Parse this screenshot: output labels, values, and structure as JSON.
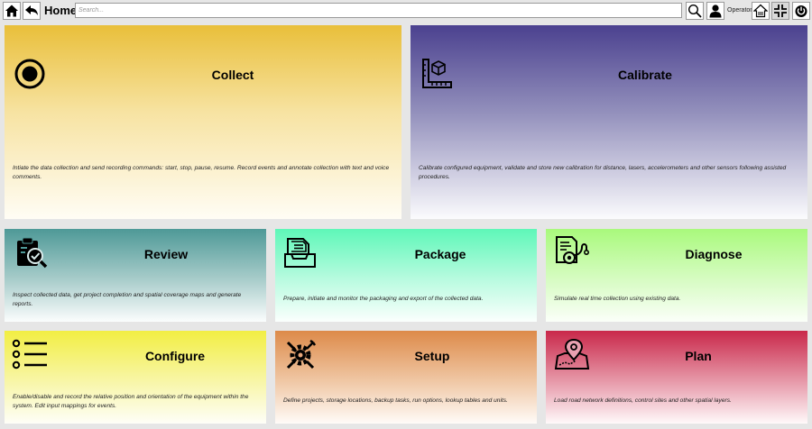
{
  "header": {
    "title": "Home",
    "search_placeholder": "Search...",
    "operator_label": "Operator",
    "icons": [
      "home-icon",
      "back-arrow-icon",
      "search-icon",
      "user-icon",
      "home-outline-icon",
      "minimize-icon",
      "power-icon"
    ]
  },
  "cards": {
    "collect": {
      "title": "Collect",
      "description": "Intiate the data collection and send recording commands: start, stop, pause, resume.  Record events and annotate collection with text and voice comments."
    },
    "calibrate": {
      "title": "Calibrate",
      "description": "Calibrate configured equipment, validate and store new calibration for distance, lasers, accelerometers and other sensors following assisted procedures."
    },
    "review": {
      "title": "Review",
      "description": "Inspect collected data, get project completion and spatial coverage maps and generate reports."
    },
    "package": {
      "title": "Package",
      "description": "Prepare, initiate and monitor the packaging and export of the collected data."
    },
    "diagnose": {
      "title": "Diagnose",
      "description": "Simulate real time collection using existing data."
    },
    "configure": {
      "title": "Configure",
      "description": "Enable/disable and record the relative position and orientation of the equipment within the system.  Edit input mappings for events."
    },
    "setup": {
      "title": "Setup",
      "description": "Define projects, storage locations, backup tasks, run options, lookup tables and units."
    },
    "plan": {
      "title": "Plan",
      "description": "Load road network definitions, control sites and other spatial layers."
    }
  },
  "colors": {
    "collect": "#e9bf3a",
    "calibrate": "#4b418f",
    "review": "#4e9997",
    "package": "#5ef7b8",
    "diagnose": "#a9f97c",
    "configure": "#f2ee43",
    "setup": "#dd8a49",
    "plan": "#c9284a"
  }
}
